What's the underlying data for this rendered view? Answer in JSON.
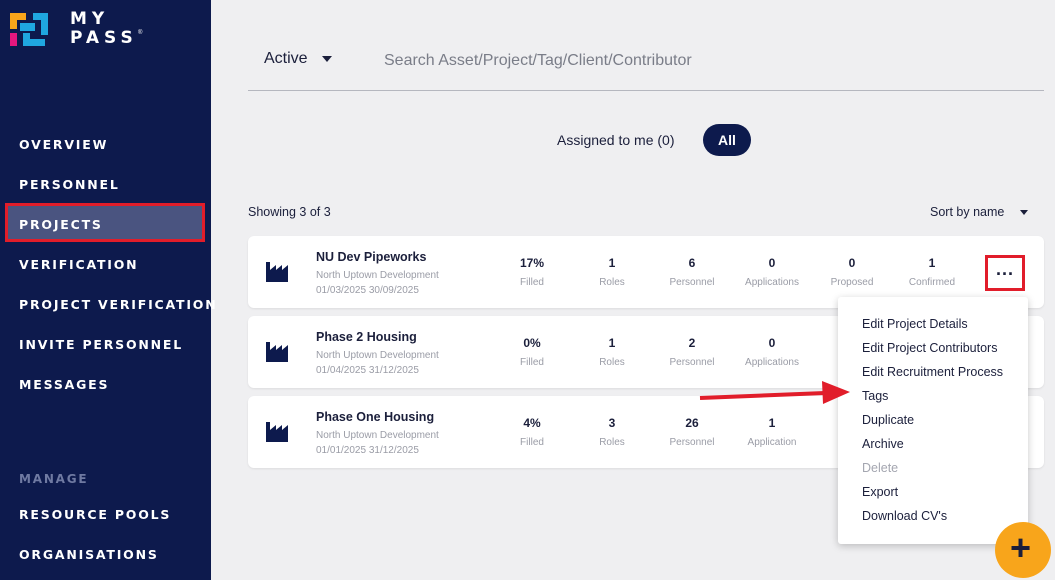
{
  "brand": {
    "logo_text": "MY PASS",
    "reg_mark": "®"
  },
  "sidebar": {
    "items": [
      {
        "label": "OVERVIEW"
      },
      {
        "label": "PERSONNEL"
      },
      {
        "label": "PROJECTS",
        "active": true
      },
      {
        "label": "VERIFICATION"
      },
      {
        "label": "PROJECT VERIFICATION"
      },
      {
        "label": "INVITE PERSONNEL"
      },
      {
        "label": "MESSAGES"
      }
    ],
    "section_label": "MANAGE",
    "manage_items": [
      {
        "label": "RESOURCE POOLS"
      },
      {
        "label": "ORGANISATIONS"
      }
    ]
  },
  "filter": {
    "status_value": "Active"
  },
  "search": {
    "placeholder": "Search Asset/Project/Tag/Client/Contributor"
  },
  "toggle": {
    "assigned_label": "Assigned to me (0)",
    "all_label": "All"
  },
  "list": {
    "showing_text": "Showing 3 of 3",
    "sort_label": "Sort by name"
  },
  "projects": [
    {
      "name": "NU Dev Pipeworks",
      "client": "North Uptown Development",
      "dates": "01/03/2025 30/09/2025",
      "filled": "17%",
      "filled_label": "Filled",
      "roles": "1",
      "roles_label": "Roles",
      "personnel": "6",
      "personnel_label": "Personnel",
      "applications": "0",
      "applications_label": "Applications",
      "proposed": "0",
      "proposed_label": "Proposed",
      "confirmed": "1",
      "confirmed_label": "Confirmed"
    },
    {
      "name": "Phase 2 Housing",
      "client": "North Uptown Development",
      "dates": "01/04/2025 31/12/2025",
      "filled": "0%",
      "filled_label": "Filled",
      "roles": "1",
      "roles_label": "Roles",
      "personnel": "2",
      "personnel_label": "Personnel",
      "applications": "0",
      "applications_label": "Applications"
    },
    {
      "name": "Phase One Housing",
      "client": "North Uptown Development",
      "dates": "01/01/2025 31/12/2025",
      "filled": "4%",
      "filled_label": "Filled",
      "roles": "3",
      "roles_label": "Roles",
      "personnel": "26",
      "personnel_label": "Personnel",
      "applications": "1",
      "applications_label": "Application"
    }
  ],
  "menu": {
    "items": [
      {
        "label": "Edit Project Details"
      },
      {
        "label": "Edit Project Contributors"
      },
      {
        "label": "Edit Recruitment Process"
      },
      {
        "label": "Tags"
      },
      {
        "label": "Duplicate"
      },
      {
        "label": "Archive"
      },
      {
        "label": "Delete",
        "disabled": true
      },
      {
        "label": "Export"
      },
      {
        "label": "Download CV's"
      }
    ]
  },
  "fab": {
    "label": "+"
  },
  "colors": {
    "sidebar": "#0d1a4d",
    "accent": "#f8a51b",
    "highlight": "#e11d2a",
    "active_nav": "#4a5480"
  }
}
